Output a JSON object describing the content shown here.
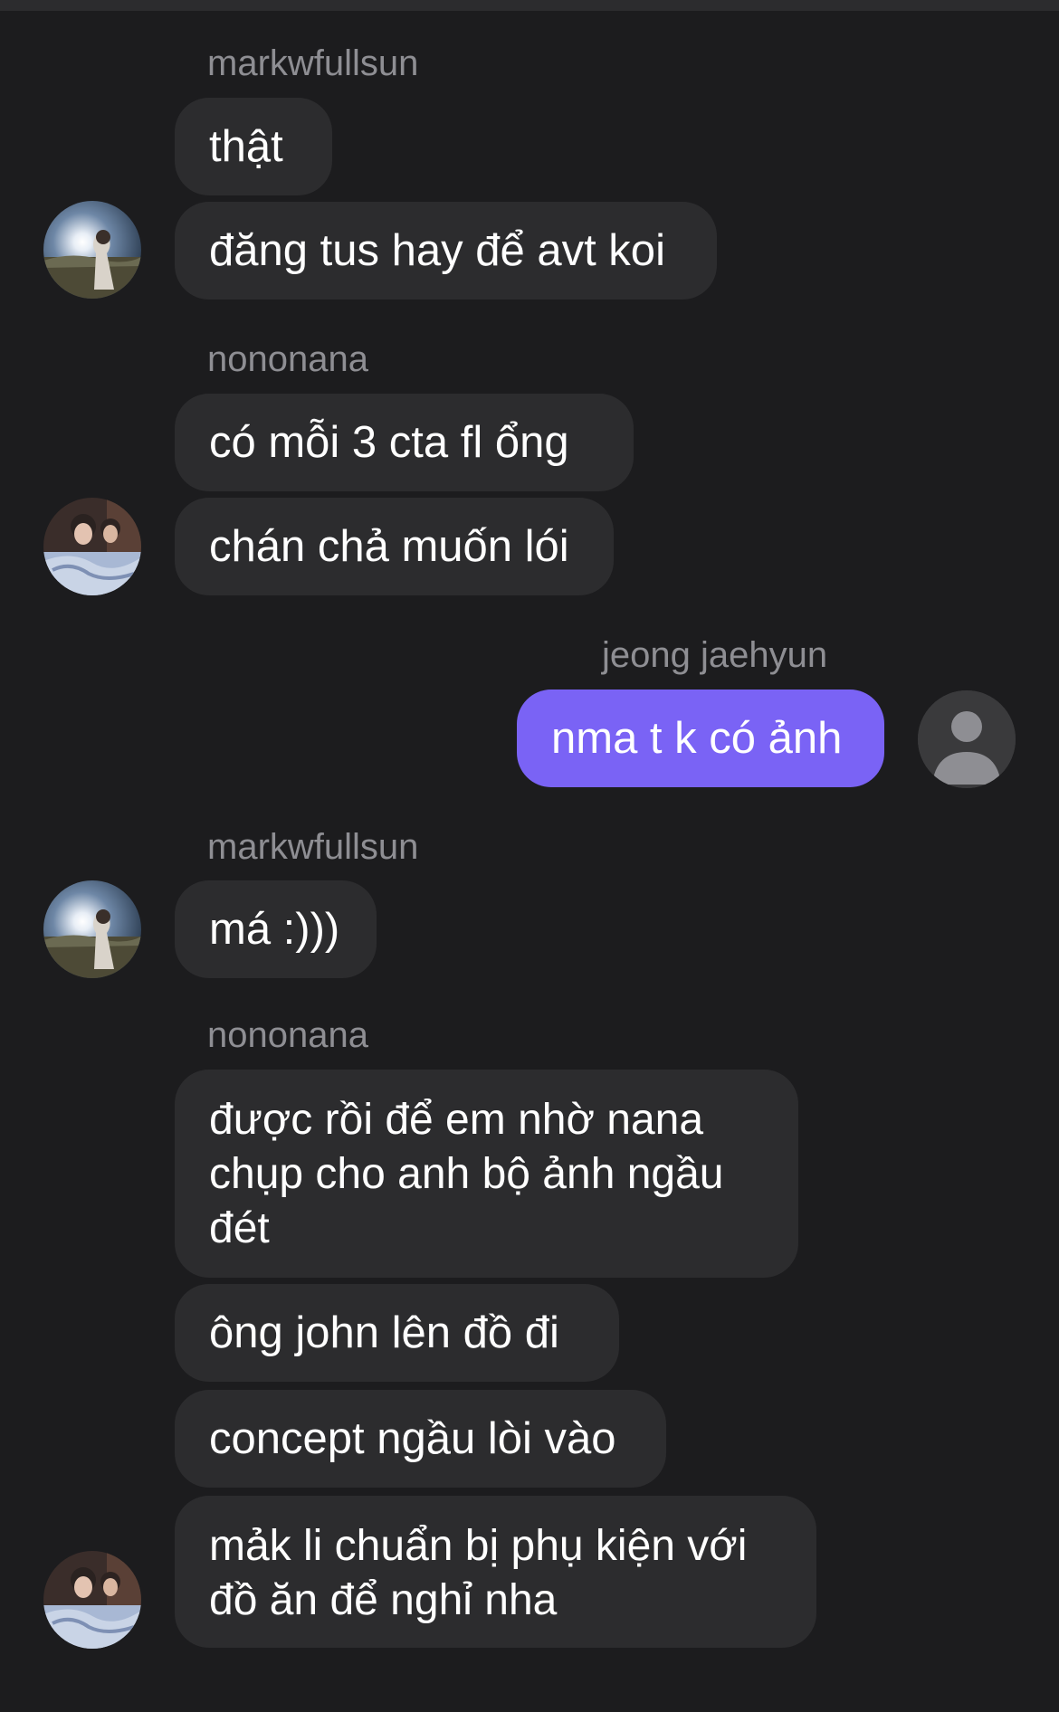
{
  "colors": {
    "background": "#1c1c1e",
    "bubble_received": "#2c2c2e",
    "bubble_sent": "#7a63f5",
    "sender_name": "#8e8e93"
  },
  "groups": [
    {
      "sender": "markwfullsun",
      "avatar": "sunset-photo-avatar",
      "messages": [
        "thật",
        "đăng tus hay để avt koi"
      ]
    },
    {
      "sender": "nononana",
      "avatar": "bed-photo-avatar",
      "messages": [
        "có mỗi 3 cta fl ổng",
        "chán chả muốn lói"
      ]
    },
    {
      "sender": "jeong jaehyun",
      "avatar": "default-person-icon",
      "messages": [
        "nma t k có ảnh"
      ]
    },
    {
      "sender": "markwfullsun",
      "avatar": "sunset-photo-avatar",
      "messages": [
        "má :)))"
      ]
    },
    {
      "sender": "nononana",
      "avatar": "bed-photo-avatar",
      "messages": [
        "được rồi để em nhờ nana chụp cho anh bộ ảnh ngầu đét",
        "ông john lên đồ đi",
        "concept ngầu lòi vào",
        "mảk li chuẩn bị phụ kiện với đồ ăn để nghỉ nha"
      ]
    }
  ]
}
